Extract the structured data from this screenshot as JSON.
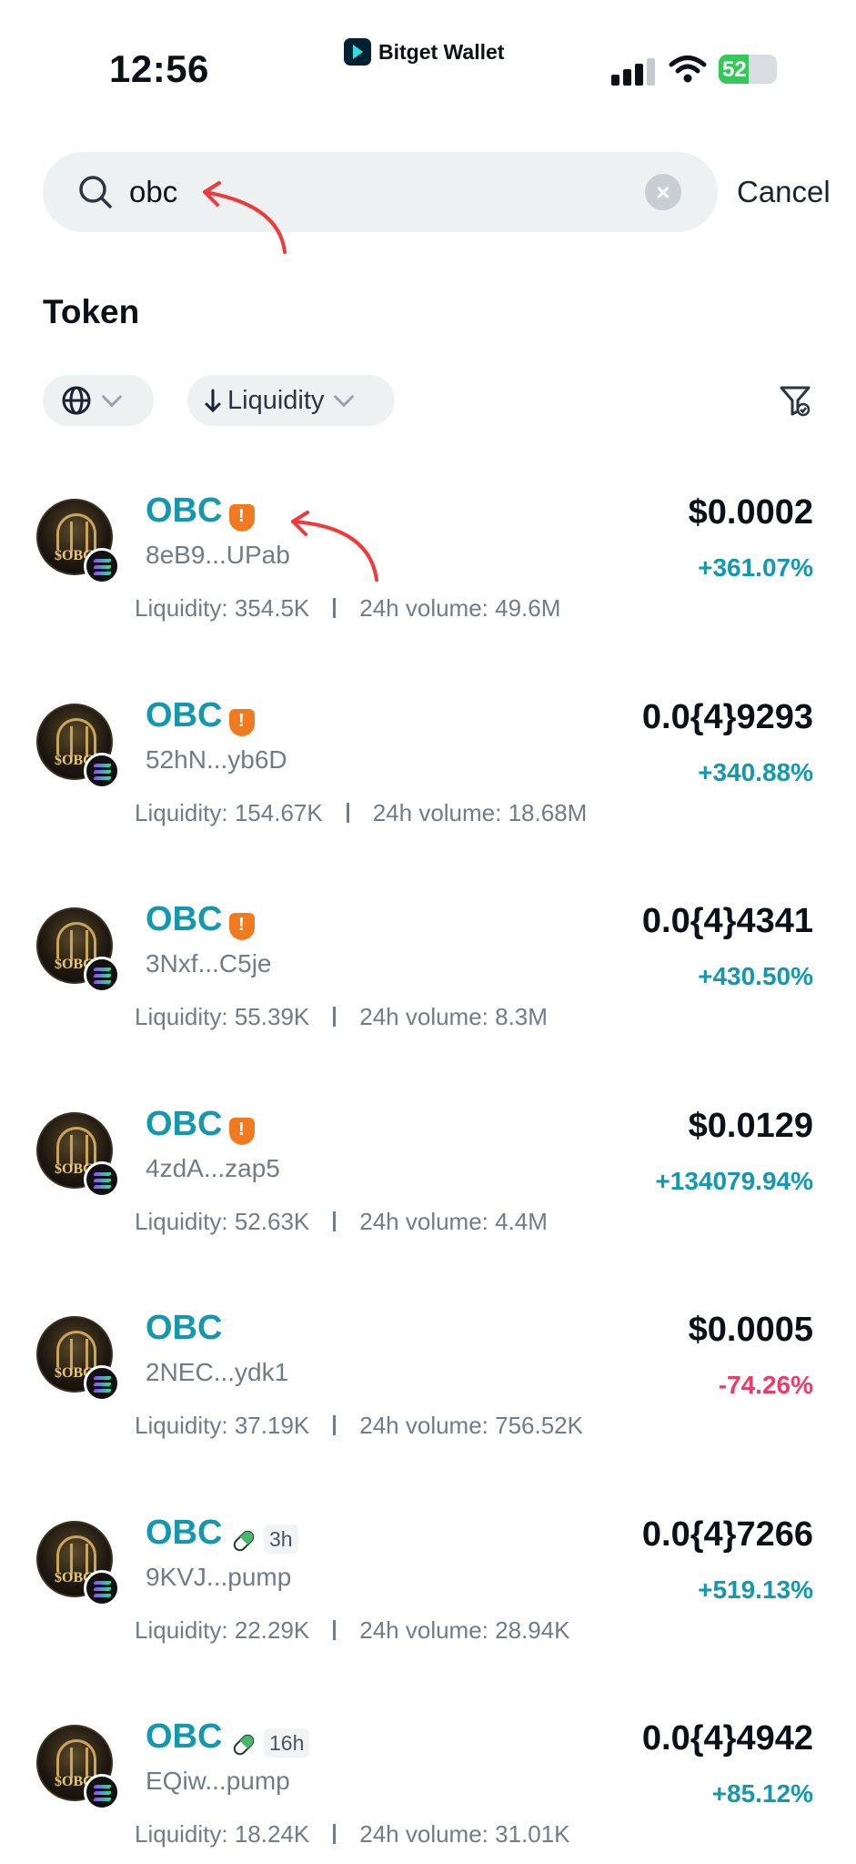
{
  "status_bar": {
    "time": "12:56",
    "battery": "52",
    "battery_level": 0.52
  },
  "brand": {
    "name": "Bitget Wallet"
  },
  "search": {
    "value": "obc",
    "cancel_label": "Cancel"
  },
  "section": {
    "title": "Token"
  },
  "filters": {
    "sort_label": "Liquidity"
  },
  "tokens": [
    {
      "name": "OBC",
      "address": "8eB9...UPab",
      "liquidity": "Liquidity: 354.5K",
      "volume": "24h volume: 49.6M",
      "price": "$0.0002",
      "change": "+361.07%",
      "direction": "up",
      "badge": "risk",
      "age": ""
    },
    {
      "name": "OBC",
      "address": "52hN...yb6D",
      "liquidity": "Liquidity: 154.67K",
      "volume": "24h volume: 18.68M",
      "price": "0.0{4}9293",
      "change": "+340.88%",
      "direction": "up",
      "badge": "risk",
      "age": ""
    },
    {
      "name": "OBC",
      "address": "3Nxf...C5je",
      "liquidity": "Liquidity: 55.39K",
      "volume": "24h volume: 8.3M",
      "price": "0.0{4}4341",
      "change": "+430.50%",
      "direction": "up",
      "badge": "risk",
      "age": ""
    },
    {
      "name": "OBC",
      "address": "4zdA...zap5",
      "liquidity": "Liquidity: 52.63K",
      "volume": "24h volume: 4.4M",
      "price": "$0.0129",
      "change": "+134079.94%",
      "direction": "up",
      "badge": "risk",
      "age": ""
    },
    {
      "name": "OBC",
      "address": "2NEC...ydk1",
      "liquidity": "Liquidity: 37.19K",
      "volume": "24h volume: 756.52K",
      "price": "$0.0005",
      "change": "-74.26%",
      "direction": "down",
      "badge": "none",
      "age": ""
    },
    {
      "name": "OBC",
      "address": "9KVJ...pump",
      "liquidity": "Liquidity: 22.29K",
      "volume": "24h volume: 28.94K",
      "price": "0.0{4}7266",
      "change": "+519.13%",
      "direction": "up",
      "badge": "pill",
      "age": "3h"
    },
    {
      "name": "OBC",
      "address": "EQiw...pump",
      "liquidity": "Liquidity: 18.24K",
      "volume": "24h volume: 31.01K",
      "price": "0.0{4}4942",
      "change": "+85.12%",
      "direction": "up",
      "badge": "pill",
      "age": "16h"
    }
  ],
  "colors": {
    "token_name": "#1597ae",
    "positive": "#1597ae",
    "negative": "#e83d6b",
    "risk_badge": "#f17a21",
    "annotation_arrow": "#ee3a3a"
  }
}
